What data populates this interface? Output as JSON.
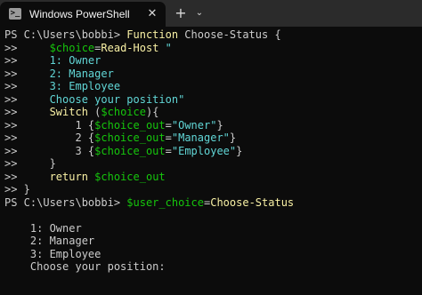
{
  "window": {
    "tab_title": "Windows PowerShell",
    "tab_icon": "powershell-icon",
    "close_glyph": "✕",
    "new_tab_glyph": "+",
    "dropdown_glyph": "⌄"
  },
  "colors": {
    "background": "#0c0c0c",
    "titlebar": "#2b2b2b",
    "default_text": "#cccccc",
    "command": "#f9f1a5",
    "variable": "#16c60c",
    "string": "#61d6d6"
  },
  "console": {
    "lines": [
      [
        {
          "t": "PS C:\\Users\\bobbi> ",
          "c": "w"
        },
        {
          "t": "Function",
          "c": "y"
        },
        {
          "t": " Choose-Status {",
          "c": "w"
        }
      ],
      [
        {
          "t": ">>     ",
          "c": "w"
        },
        {
          "t": "$choice",
          "c": "g"
        },
        {
          "t": "=",
          "c": "w"
        },
        {
          "t": "Read-Host",
          "c": "y"
        },
        {
          "t": " \"",
          "c": "c"
        }
      ],
      [
        {
          "t": ">>     ",
          "c": "w"
        },
        {
          "t": "1: Owner",
          "c": "c"
        }
      ],
      [
        {
          "t": ">>     ",
          "c": "w"
        },
        {
          "t": "2: Manager",
          "c": "c"
        }
      ],
      [
        {
          "t": ">>     ",
          "c": "w"
        },
        {
          "t": "3: Employee",
          "c": "c"
        }
      ],
      [
        {
          "t": ">>     ",
          "c": "w"
        },
        {
          "t": "Choose your position\"",
          "c": "c"
        }
      ],
      [
        {
          "t": ">>     ",
          "c": "w"
        },
        {
          "t": "Switch",
          "c": "y"
        },
        {
          "t": " (",
          "c": "w"
        },
        {
          "t": "$choice",
          "c": "g"
        },
        {
          "t": "){",
          "c": "w"
        }
      ],
      [
        {
          "t": ">>         1 {",
          "c": "w"
        },
        {
          "t": "$choice_out",
          "c": "g"
        },
        {
          "t": "=",
          "c": "w"
        },
        {
          "t": "\"Owner\"",
          "c": "c"
        },
        {
          "t": "}",
          "c": "w"
        }
      ],
      [
        {
          "t": ">>         2 {",
          "c": "w"
        },
        {
          "t": "$choice_out",
          "c": "g"
        },
        {
          "t": "=",
          "c": "w"
        },
        {
          "t": "\"Manager\"",
          "c": "c"
        },
        {
          "t": "}",
          "c": "w"
        }
      ],
      [
        {
          "t": ">>         3 {",
          "c": "w"
        },
        {
          "t": "$choice_out",
          "c": "g"
        },
        {
          "t": "=",
          "c": "w"
        },
        {
          "t": "\"Employee\"",
          "c": "c"
        },
        {
          "t": "}",
          "c": "w"
        }
      ],
      [
        {
          "t": ">>     }",
          "c": "w"
        }
      ],
      [
        {
          "t": ">>     ",
          "c": "w"
        },
        {
          "t": "return",
          "c": "y"
        },
        {
          "t": " ",
          "c": "w"
        },
        {
          "t": "$choice_out",
          "c": "g"
        }
      ],
      [
        {
          "t": ">> }",
          "c": "w"
        }
      ],
      [
        {
          "t": "PS C:\\Users\\bobbi> ",
          "c": "w"
        },
        {
          "t": "$user_choice",
          "c": "g"
        },
        {
          "t": "=",
          "c": "w"
        },
        {
          "t": "Choose-Status",
          "c": "y"
        }
      ],
      [],
      [
        {
          "t": "    1: Owner",
          "c": "w"
        }
      ],
      [
        {
          "t": "    2: Manager",
          "c": "w"
        }
      ],
      [
        {
          "t": "    3: Employee",
          "c": "w"
        }
      ],
      [
        {
          "t": "    Choose your position:",
          "c": "w"
        }
      ]
    ]
  }
}
